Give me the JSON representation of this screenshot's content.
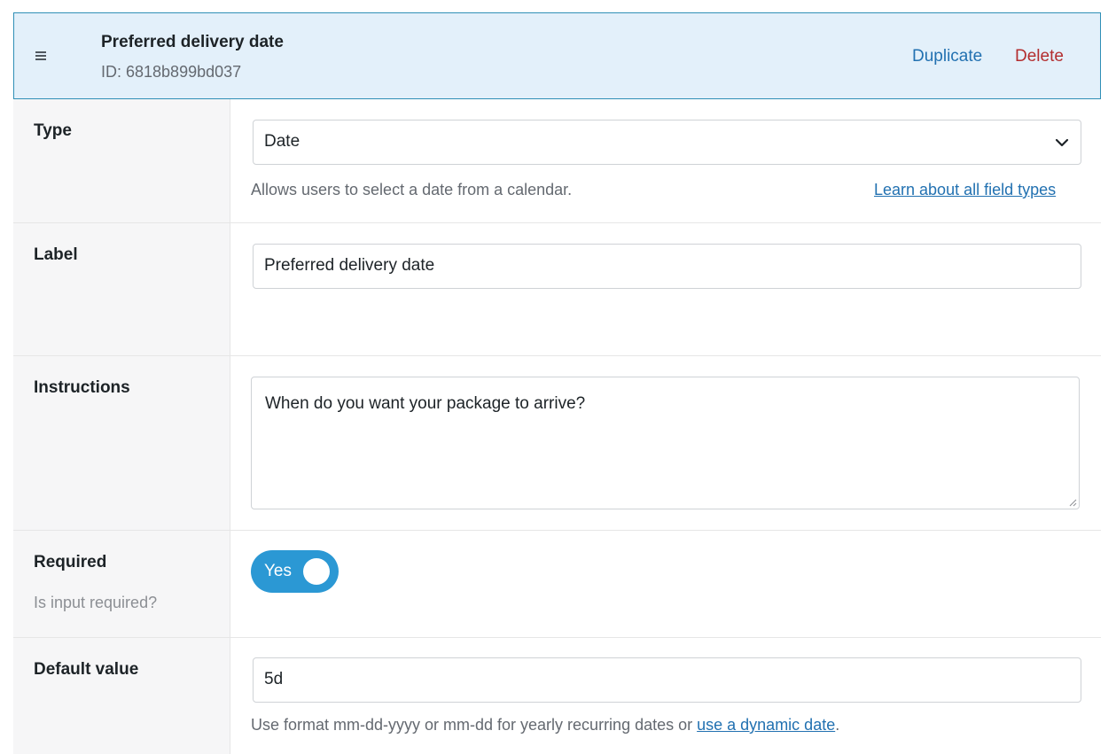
{
  "header": {
    "title": "Preferred delivery date",
    "id_text": "ID: 6818b899bd037",
    "duplicate_label": "Duplicate",
    "delete_label": "Delete",
    "drag_icon": "drag-handle-icon"
  },
  "type_row": {
    "label": "Type",
    "value": "Date",
    "help": "Allows users to select a date from a calendar.",
    "link": "Learn about all field types"
  },
  "label_row": {
    "label": "Label",
    "value": "Preferred delivery date"
  },
  "instructions_row": {
    "label": "Instructions",
    "value": "When do you want your package to arrive?"
  },
  "required_row": {
    "label": "Required",
    "sublabel": "Is input required?",
    "toggle_text": "Yes",
    "toggle_on": true
  },
  "default_row": {
    "label": "Default value",
    "value": "5d",
    "help_prefix": "Use format mm-dd-yyyy or mm-dd for yearly recurring dates or ",
    "help_link": "use a dynamic date",
    "help_suffix": "."
  },
  "colors": {
    "accent": "#2271b1",
    "danger": "#b32d2e",
    "header_bg": "#e3f0fa",
    "toggle_on": "#2b98d4"
  }
}
